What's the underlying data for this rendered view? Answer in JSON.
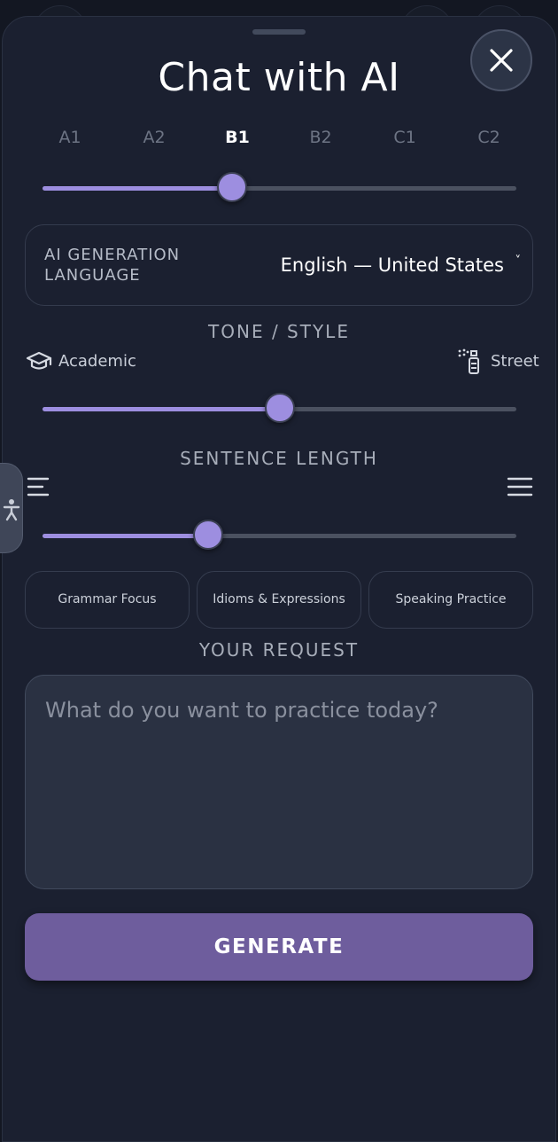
{
  "title": "Chat with AI",
  "levels": {
    "items": [
      "A1",
      "A2",
      "B1",
      "B2",
      "C1",
      "C2"
    ],
    "selected": "B1"
  },
  "level_slider": {
    "value_fraction": 0.4
  },
  "generation_language": {
    "label": "AI GENERATION\nLANGUAGE",
    "value": "English — United States",
    "chevron": "˅"
  },
  "tone": {
    "heading": "TONE / STYLE",
    "left_label": "Academic",
    "right_label": "Street",
    "left_icon": "graduation-cap-icon",
    "right_icon": "spray-can-icon",
    "value_fraction": 0.5
  },
  "sentence_length": {
    "heading": "SENTENCE LENGTH",
    "left_icon": "short-lines-icon",
    "right_icon": "long-lines-icon",
    "value_fraction": 0.35
  },
  "chips": [
    "Grammar Focus",
    "Idioms & Expressions",
    "Speaking Practice"
  ],
  "request": {
    "heading": "YOUR REQUEST",
    "placeholder": "What do you want to practice today?"
  },
  "generate_label": "GENERATE",
  "colors": {
    "accent": "#9d8ee0",
    "button": "#6e5d9d",
    "sheet": "#1b2030",
    "background": "#131722"
  }
}
